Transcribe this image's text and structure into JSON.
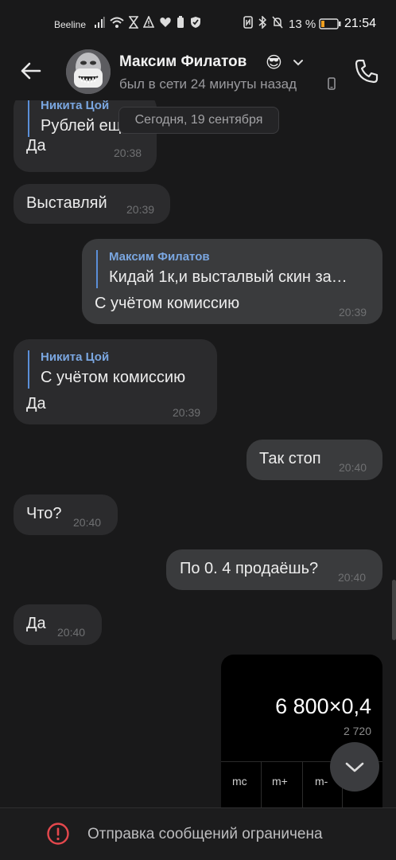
{
  "status_bar": {
    "carrier": "Beeline",
    "battery_percent": "13 %",
    "time": "21:54"
  },
  "header": {
    "contact_name": "Максим Филатов",
    "contact_emoji": "😎",
    "last_seen": "был в сети 24 минуты назад",
    "back_icon": "arrow-left-icon",
    "call_icon": "phone-icon"
  },
  "chat": {
    "date_separator": "Сегодня, 19 сентября",
    "messages": [
      {
        "direction": "in",
        "reply_name": "Никита Цой",
        "reply_text": "Рублей ещ",
        "text": "Да",
        "time": "20:38"
      },
      {
        "direction": "in",
        "text": "Выставляй",
        "time": "20:39"
      },
      {
        "direction": "out",
        "reply_name": "Максим Филатов",
        "reply_text": "Кидай 1к,и высталвый скин за…",
        "text": "С учётом комиссию",
        "time": "20:39"
      },
      {
        "direction": "in",
        "reply_name": "Никита Цой",
        "reply_text": "С учётом комиссию",
        "text": "Да",
        "time": "20:39"
      },
      {
        "direction": "out",
        "text": "Так стоп",
        "time": "20:40"
      },
      {
        "direction": "in",
        "text": "Что?",
        "time": "20:40"
      },
      {
        "direction": "out",
        "text": "По 0. 4 продаёшь?",
        "time": "20:40"
      },
      {
        "direction": "in",
        "text": "Да",
        "time": "20:40"
      }
    ],
    "photo": {
      "expression": "6 800×0,4",
      "result": "2 720",
      "keys": [
        "mc",
        "m+",
        "m-"
      ]
    }
  },
  "footer": {
    "notice": "Отправка сообщений ограничена",
    "icon": "alert-circle-icon"
  },
  "colors": {
    "background": "#19191a",
    "incoming_bubble": "#2b2b2d",
    "outgoing_bubble": "#3a3b3d",
    "reply_accent": "#7aa6e0",
    "warning": "#e5484d"
  }
}
